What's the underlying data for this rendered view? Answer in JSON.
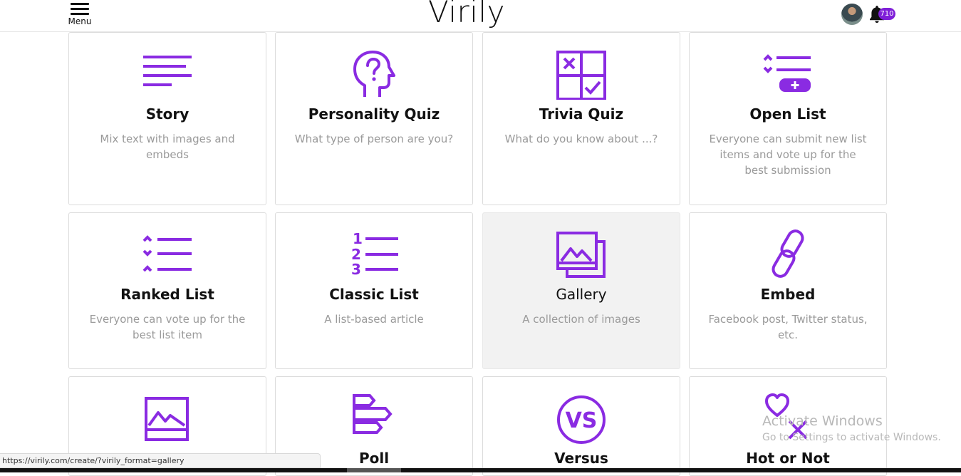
{
  "header": {
    "menu_label": "Menu",
    "logo": "Virily",
    "notification_count": "710"
  },
  "colors": {
    "accent": "#8a2be2",
    "badge": "#7f1fd8",
    "muted_text": "#9a9a9a",
    "active_card_bg": "#f2f2f2"
  },
  "formats": [
    {
      "title": "Story",
      "desc": "Mix text with images and embeds",
      "icon": "text-lines-icon"
    },
    {
      "title": "Personality Quiz",
      "desc": "What type of person are you?",
      "icon": "head-question-icon"
    },
    {
      "title": "Trivia Quiz",
      "desc": "What do you know about ...?",
      "icon": "check-grid-icon"
    },
    {
      "title": "Open List",
      "desc": "Everyone can submit new list items and vote up for the best submission",
      "icon": "open-list-icon"
    },
    {
      "title": "Ranked List",
      "desc": "Everyone can vote up for the best list item",
      "icon": "ranked-list-icon"
    },
    {
      "title": "Classic List",
      "desc": "A list-based article",
      "icon": "numbered-list-icon"
    },
    {
      "title": "Gallery",
      "desc": "A collection of images",
      "icon": "gallery-icon"
    },
    {
      "title": "Embed",
      "desc": "Facebook post, Twitter status, etc.",
      "icon": "link-icon"
    },
    {
      "title": "",
      "desc": "",
      "icon": "image-icon"
    },
    {
      "title": "Poll",
      "desc": "",
      "icon": "poll-icon"
    },
    {
      "title": "Versus",
      "desc": "",
      "icon": "versus-icon"
    },
    {
      "title": "Hot or Not",
      "desc": "",
      "icon": "heart-x-icon"
    }
  ],
  "status_url": "https://virily.com/create/?virily_format=gallery",
  "watermark": {
    "line1": "Activate Windows",
    "line2": "Go to Settings to activate Windows."
  }
}
